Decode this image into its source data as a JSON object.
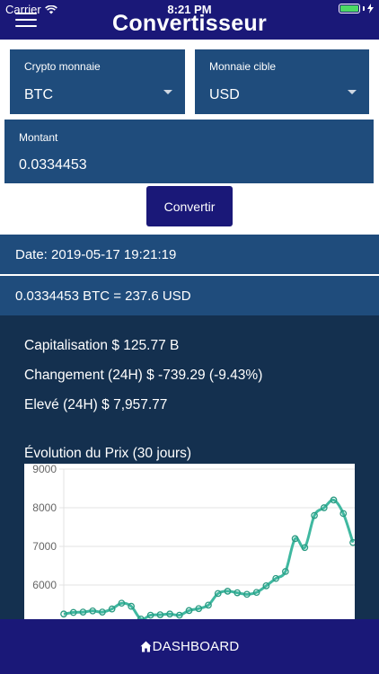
{
  "status": {
    "carrier": "Carrier",
    "time": "8:21 PM",
    "battery_level": 1.0
  },
  "header": {
    "title": "Convertisseur"
  },
  "form": {
    "crypto": {
      "label": "Crypto monnaie",
      "value": "BTC"
    },
    "target": {
      "label": "Monnaie cible",
      "value": "USD"
    },
    "amount": {
      "label": "Montant",
      "value": "0.0334453"
    },
    "convert_label": "Convertir"
  },
  "result": {
    "date": "Date: 2019-05-17 19:21:19",
    "conversion": "0.0334453 BTC = 237.6 USD"
  },
  "stats": {
    "cap": "Capitalisation $ 125.77 B",
    "change": "Changement (24H) $ -739.29 (-9.43%)",
    "high": "Elevé (24H) $ 7,957.77"
  },
  "chart_data": {
    "type": "line",
    "title": "Évolution du Prix (30 jours)",
    "ylim": [
      5100,
      9000
    ],
    "yticks": [
      "6000",
      "7000",
      "8000",
      "9000"
    ],
    "grid": true,
    "color": "#3fb8a0",
    "values": [
      5250,
      5290,
      5300,
      5330,
      5300,
      5380,
      5530,
      5450,
      5120,
      5220,
      5230,
      5250,
      5220,
      5340,
      5390,
      5480,
      5780,
      5840,
      5800,
      5760,
      5810,
      5980,
      6170,
      6350,
      7200,
      6970,
      7800,
      8000,
      8200,
      7850,
      7100
    ]
  },
  "bottom": {
    "dashboard_label": "DASHBOARD"
  }
}
